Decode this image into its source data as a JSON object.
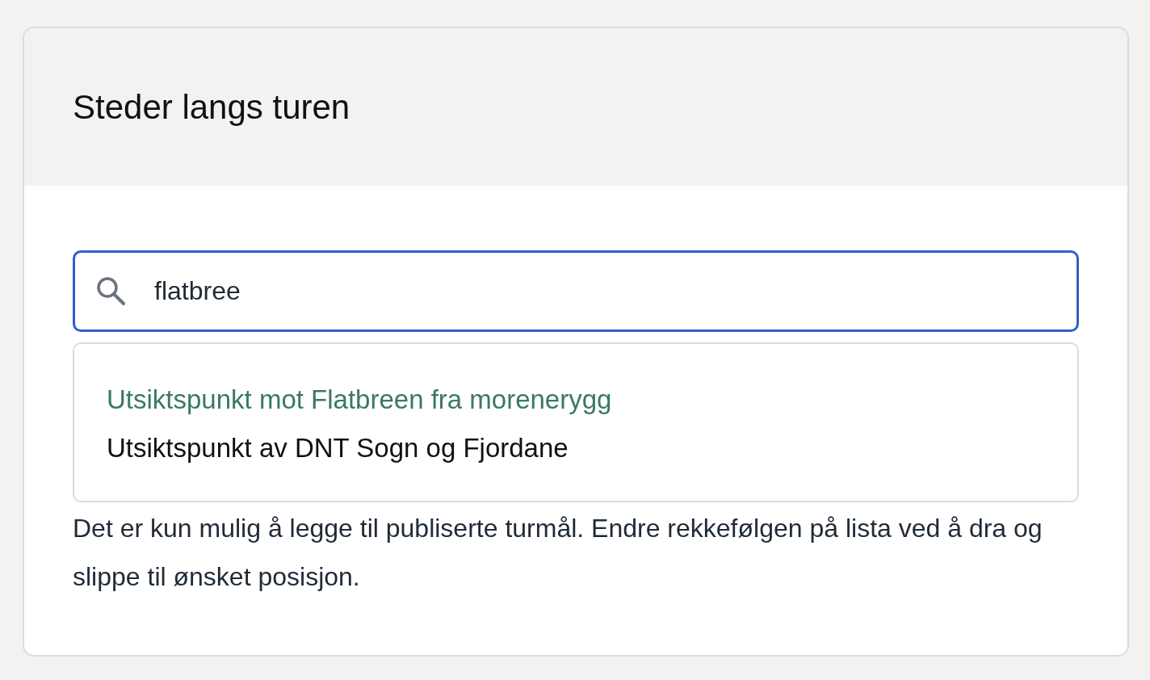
{
  "panel": {
    "title": "Steder langs turen"
  },
  "search": {
    "value": "flatbree"
  },
  "suggestions": [
    {
      "label": "Utsiktspunkt mot Flatbreen fra morenerygg",
      "selected": true
    },
    {
      "label": "Utsiktspunkt av DNT Sogn og Fjordane",
      "selected": false
    }
  ],
  "help_text": "Det er kun mulig å legge til publiserte turmål. Endre rekkefølgen på lista ved å dra og slippe til ønsket posisjon."
}
